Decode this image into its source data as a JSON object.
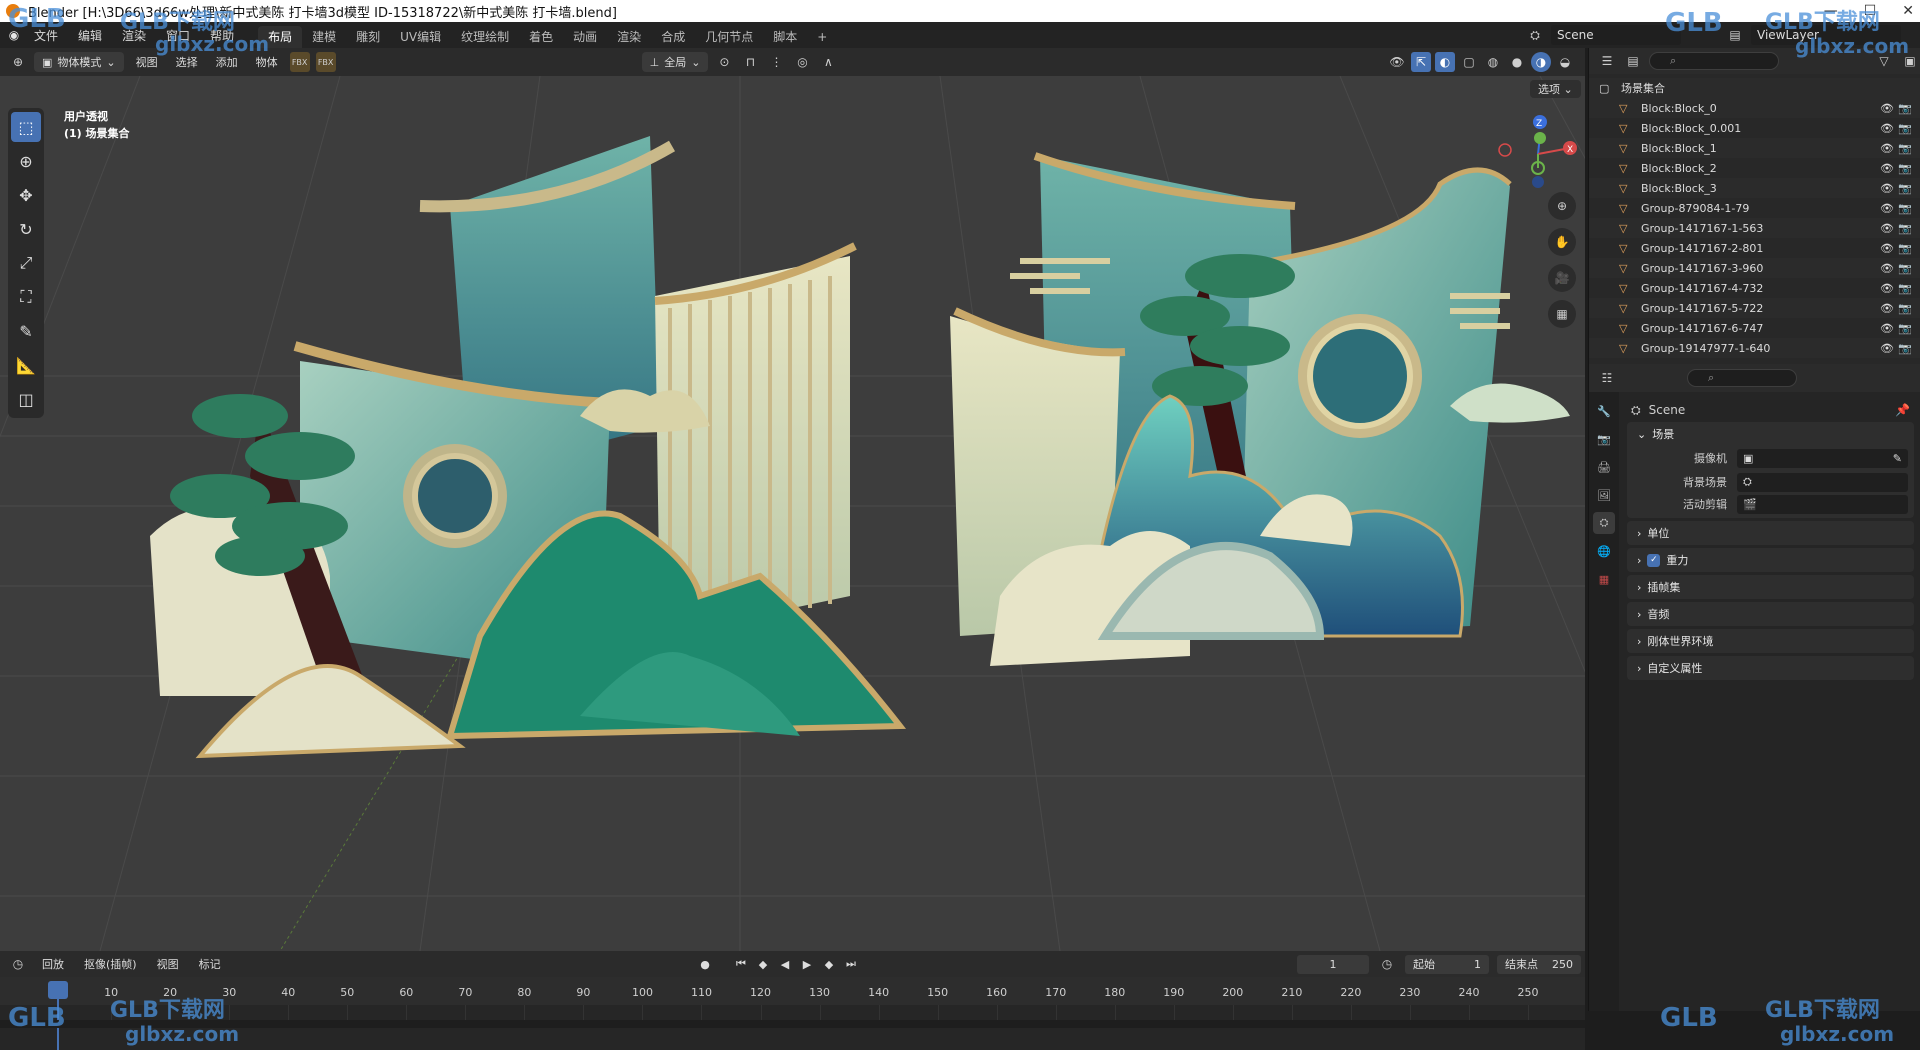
{
  "window": {
    "title": "Blender [H:\\3D66\\3d66w处理\\新中式美陈 打卡墙3d模型 ID-15318722\\新中式美陈 打卡墙.blend]"
  },
  "menu": [
    "文件",
    "编辑",
    "渲染",
    "窗口",
    "帮助"
  ],
  "workspaces": [
    "布局",
    "建模",
    "雕刻",
    "UV编辑",
    "纹理绘制",
    "着色",
    "动画",
    "渲染",
    "合成",
    "几何节点",
    "脚本"
  ],
  "active_workspace": "布局",
  "scene_selector": {
    "value": "Scene"
  },
  "viewlayer_selector": {
    "value": "ViewLayer"
  },
  "viewport_header": {
    "mode": "物体模式",
    "menus": [
      "视图",
      "选择",
      "添加",
      "物体"
    ],
    "transform_orientation": "全局",
    "options_label": "选项"
  },
  "viewport": {
    "info_line1": "用户透视",
    "info_line2": "(1) 场景集合",
    "gizmo_axes": [
      "Z",
      "Y",
      "X"
    ]
  },
  "outliner": {
    "root": "场景集合",
    "items": [
      "Block:Block_0",
      "Block:Block_0.001",
      "Block:Block_1",
      "Block:Block_2",
      "Block:Block_3",
      "Group-879084-1-79",
      "Group-1417167-1-563",
      "Group-1417167-2-801",
      "Group-1417167-3-960",
      "Group-1417167-4-732",
      "Group-1417167-5-722",
      "Group-1417167-6-747",
      "Group-19147977-1-640"
    ]
  },
  "properties": {
    "context": "Scene",
    "panel_scene": "场景",
    "camera_label": "摄像机",
    "background_label": "背景场景",
    "active_clip_label": "活动剪辑",
    "panels": [
      "单位",
      "重力",
      "插帧集",
      "音频",
      "刚体世界环境",
      "自定义属性"
    ],
    "gravity_checked": true
  },
  "timeline": {
    "menus": [
      "回放",
      "抠像(插帧)",
      "视图",
      "标记"
    ],
    "current_frame": "1",
    "start_label": "起始",
    "start": "1",
    "end_label": "结束点",
    "end": "250",
    "ticks": [
      "1",
      "10",
      "20",
      "30",
      "40",
      "50",
      "60",
      "70",
      "80",
      "90",
      "100",
      "110",
      "120",
      "130",
      "140",
      "150",
      "160",
      "170",
      "180",
      "190",
      "200",
      "210",
      "220",
      "230",
      "240",
      "250"
    ]
  },
  "watermarks": {
    "brand": "GLB下载网",
    "url": "glbxz.com",
    "logo": "GLB"
  },
  "colors": {
    "accent": "#4772b3",
    "teal": "#3e8e86",
    "gold": "#c9a96a"
  }
}
